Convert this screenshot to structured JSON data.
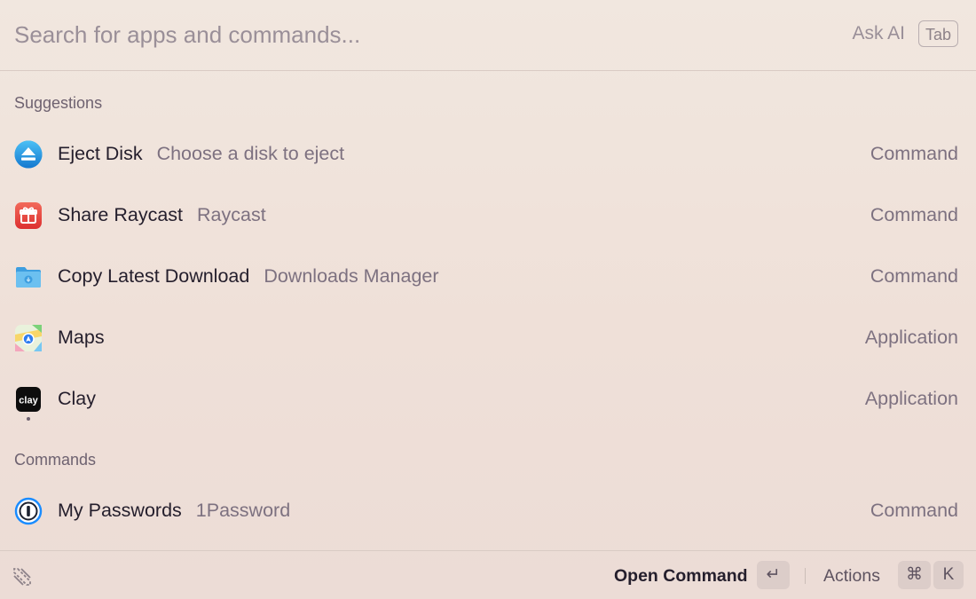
{
  "search": {
    "placeholder": "Search for apps and commands...",
    "ask_ai_label": "Ask AI",
    "tab_key": "Tab"
  },
  "sections": {
    "suggestions": "Suggestions",
    "commands": "Commands"
  },
  "rows": [
    {
      "title": "Eject Disk",
      "subtitle": "Choose a disk to eject",
      "type": "Command",
      "icon": "eject-icon"
    },
    {
      "title": "Share Raycast",
      "subtitle": "Raycast",
      "type": "Command",
      "icon": "gift-icon"
    },
    {
      "title": "Copy Latest Download",
      "subtitle": "Downloads Manager",
      "type": "Command",
      "icon": "folder-download-icon"
    },
    {
      "title": "Maps",
      "subtitle": "",
      "type": "Application",
      "icon": "maps-app-icon"
    },
    {
      "title": "Clay",
      "subtitle": "",
      "type": "Application",
      "icon": "clay-app-icon",
      "icon_text": "clay"
    },
    {
      "title": "My Passwords",
      "subtitle": "1Password",
      "type": "Command",
      "icon": "onepassword-icon"
    }
  ],
  "footer": {
    "logo": "raycast-logo-icon",
    "primary_action": "Open Command",
    "enter_key": "↵",
    "actions_label": "Actions",
    "cmd_key": "⌘",
    "k_key": "K"
  },
  "colors": {
    "background": "#f1e7df",
    "text_primary": "#241e2c",
    "text_secondary": "#7d7180",
    "eject_blue": "#1a9be6",
    "gift_red": "#e5463c",
    "folder_blue": "#5bb5ec"
  }
}
